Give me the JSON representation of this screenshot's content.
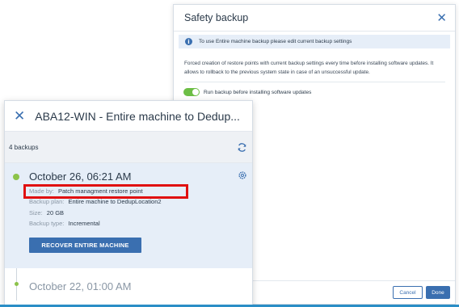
{
  "dialog": {
    "title": "Safety backup",
    "info_text": "To use Entire machine backup please edit current backup settings",
    "description": "Forced creation of restore points with current backup settings every time before installing software updates. It allows to rollback to the previous system state in case of an unsuccessful update.",
    "toggle_label": "Run backup before installing software updates",
    "toggle_on": true,
    "cancel_label": "Cancel",
    "done_label": "Done"
  },
  "panel": {
    "title": "ABA12-WIN - Entire machine to Dedup...",
    "backup_count": "4 backups",
    "backups": [
      {
        "date": "October 26, 06:21 AM",
        "made_by_label": "Made by:",
        "made_by": "Patch managment restore point",
        "plan_label": "Backup plan:",
        "plan": "Entire machine to DedupLocation2",
        "size_label": "Size:",
        "size": "20 GB",
        "type_label": "Backup type:",
        "type": "Incremental",
        "recover_label": "RECOVER ENTIRE MACHINE"
      },
      {
        "date": "October 22, 01:00 AM"
      }
    ]
  },
  "colors": {
    "accent": "#3a6fb0",
    "toggle_on": "#6cbe45",
    "timeline_dot": "#8cc34a",
    "highlight": "#e01010",
    "selected_bg": "#e6eef8"
  },
  "icons": [
    "close-icon",
    "info-icon",
    "refresh-icon",
    "gear-icon"
  ]
}
